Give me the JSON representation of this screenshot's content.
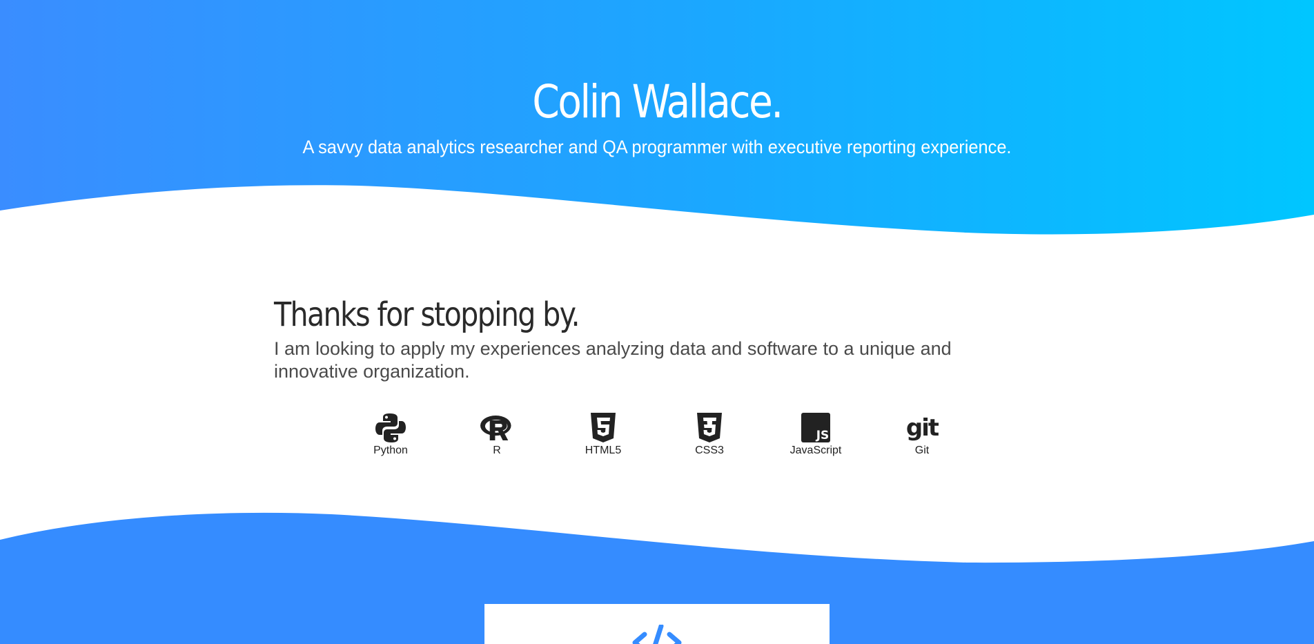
{
  "hero": {
    "name": "Colin Wallace.",
    "tagline": "A savvy data analytics researcher and QA programmer with executive reporting experience."
  },
  "about": {
    "heading": "Thanks for stopping by.",
    "text": "I am looking to apply my experiences analyzing data and software to a unique and innovative organization."
  },
  "skills": [
    {
      "label": "Python",
      "icon": "python-icon"
    },
    {
      "label": "R",
      "icon": "r-icon"
    },
    {
      "label": "HTML5",
      "icon": "html5-icon"
    },
    {
      "label": "CSS3",
      "icon": "css3-icon"
    },
    {
      "label": "JavaScript",
      "icon": "javascript-icon"
    },
    {
      "label": "Git",
      "icon": "git-icon"
    }
  ],
  "project_card": {
    "icon": "code-icon"
  },
  "colors": {
    "gradient_start": "#3a8dff",
    "gradient_end": "#00c6ff",
    "footer_blue": "#358cff",
    "icon_dark": "#222222"
  }
}
